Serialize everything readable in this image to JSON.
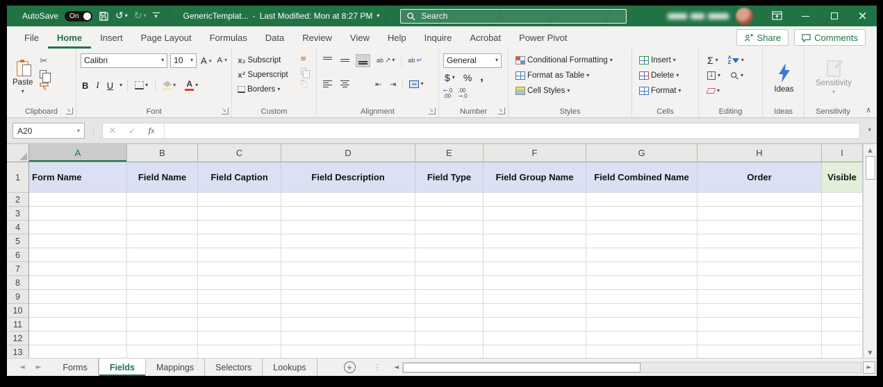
{
  "titlebar": {
    "autosave_label": "AutoSave",
    "autosave_state": "On",
    "doc_title": "GenericTemplat...",
    "dash": "-",
    "last_modified": "Last Modified: Mon at 8:27 PM",
    "search_placeholder": "Search"
  },
  "menu": {
    "tabs": [
      {
        "label": "File",
        "active": false
      },
      {
        "label": "Home",
        "active": true
      },
      {
        "label": "Insert",
        "active": false
      },
      {
        "label": "Page Layout",
        "active": false
      },
      {
        "label": "Formulas",
        "active": false
      },
      {
        "label": "Data",
        "active": false
      },
      {
        "label": "Review",
        "active": false
      },
      {
        "label": "View",
        "active": false
      },
      {
        "label": "Help",
        "active": false
      },
      {
        "label": "Inquire",
        "active": false
      },
      {
        "label": "Acrobat",
        "active": false
      },
      {
        "label": "Power Pivot",
        "active": false
      }
    ],
    "share_label": "Share",
    "comments_label": "Comments"
  },
  "ribbon": {
    "clipboard": {
      "label": "Clipboard",
      "paste": "Paste"
    },
    "font": {
      "label": "Font",
      "family": "Calibri",
      "size": "10",
      "bold": "B",
      "italic": "I",
      "underline": "U",
      "grow_glyph": "A",
      "shrink_glyph": "A",
      "color_glyph": "A"
    },
    "custom": {
      "label": "Custom",
      "sub_prefix": "x₂",
      "subscript": "Subscript",
      "sup_prefix": "x²",
      "superscript": "Superscript",
      "borders": "Borders"
    },
    "alignment": {
      "label": "Alignment",
      "orientation_glyph": "ab",
      "wrap_glyph": "ab"
    },
    "number": {
      "label": "Number",
      "format": "General",
      "currency": "$",
      "percent": "%",
      "comma": ",",
      "inc_decimal_glyph": "←.0 .00",
      "dec_decimal_glyph": ".00 →.0"
    },
    "styles": {
      "label": "Styles",
      "conditional": "Conditional Formatting",
      "format_table": "Format as Table",
      "cell_styles": "Cell Styles"
    },
    "cells": {
      "label": "Cells",
      "insert": "Insert",
      "delete": "Delete",
      "format": "Format"
    },
    "editing": {
      "label": "Editing",
      "sum_glyph": "Σ",
      "sort_a": "A",
      "sort_z": "Z"
    },
    "ideas": {
      "label": "Ideas",
      "button": "Ideas"
    },
    "sensitivity": {
      "label": "Sensitivity",
      "button": "Sensitivity"
    }
  },
  "formula_bar": {
    "name_box": "A20",
    "fx": "fx"
  },
  "sheet": {
    "col_headers": [
      "A",
      "B",
      "C",
      "D",
      "E",
      "F",
      "G",
      "H",
      "I"
    ],
    "selected_col": "A",
    "row_numbers": [
      "1",
      "2",
      "3",
      "4",
      "5",
      "6",
      "7",
      "8",
      "9",
      "10",
      "11",
      "12",
      "13"
    ],
    "header_row": [
      "Form Name",
      "Field Name",
      "Field Caption",
      "Field Description",
      "Field Type",
      "Field Group Name",
      "Field Combined Name",
      "Order",
      "Visible"
    ],
    "header_fill": "#D9E1F2",
    "visible_fill": "#E2EFDA"
  },
  "sheet_tabs": {
    "tabs": [
      {
        "label": "Forms",
        "active": false
      },
      {
        "label": "Fields",
        "active": true
      },
      {
        "label": "Mappings",
        "active": false
      },
      {
        "label": "Selectors",
        "active": false
      },
      {
        "label": "Lookups",
        "active": false
      }
    ]
  },
  "colors": {
    "accent_green": "#217346",
    "header_fill": "#D9E1F2",
    "visible_fill": "#E2EFDA"
  }
}
